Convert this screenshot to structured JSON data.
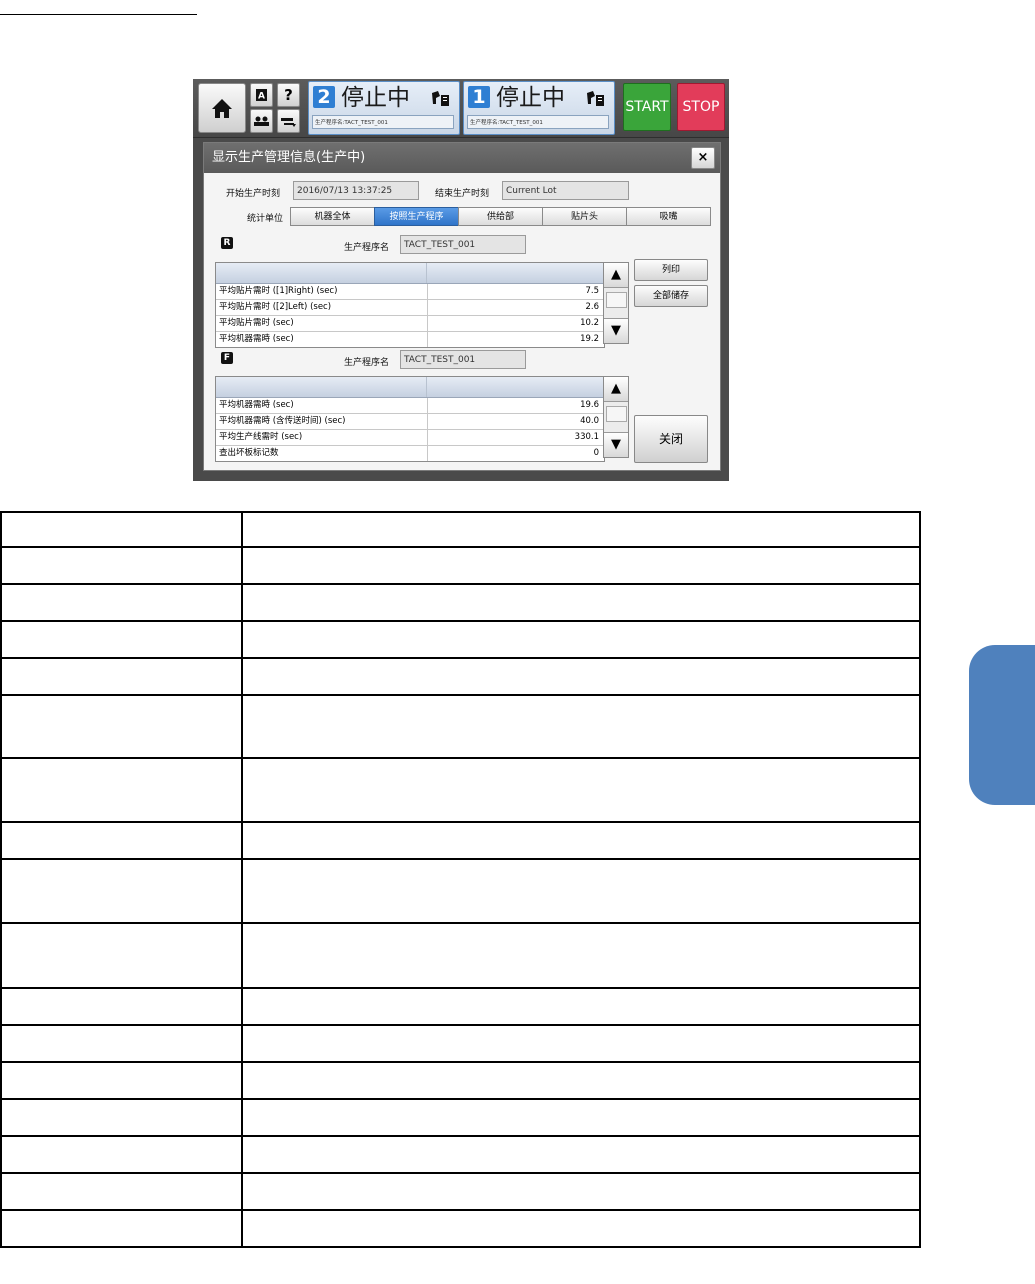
{
  "app": {
    "status_1": {
      "number": "2",
      "state": "停止中",
      "program": "生产程序名:TACT_TEST_001"
    },
    "status_2": {
      "number": "1",
      "state": "停止中",
      "program": "生产程序名:TACT_TEST_001"
    },
    "start_label": "START",
    "stop_label": "STOP",
    "help_label": "?",
    "a_label": "A"
  },
  "dialog": {
    "title": "显示生产管理信息(生产中)",
    "close_label": "×",
    "start_time_label": "开始生产时刻",
    "start_time_value": "2016/07/13 13:37:25",
    "end_time_label": "结束生产时刻",
    "end_time_value": "Current Lot",
    "unit_label": "统计单位",
    "tabs": [
      "机器全体",
      "按照生产程序",
      "供给部",
      "贴片头",
      "吸嘴"
    ],
    "active_tab": "按照生产程序",
    "rear": {
      "badge": "R",
      "program_label": "生产程序名",
      "program_value": "TACT_TEST_001",
      "rows": [
        {
          "k": "平均贴片需时 ([1]Right) (sec)",
          "v": "7.5"
        },
        {
          "k": "平均贴片需时 ([2]Left) (sec)",
          "v": "2.6"
        },
        {
          "k": "平均贴片需时 (sec)",
          "v": "10.2"
        },
        {
          "k": "平均机器需時 (sec)",
          "v": "19.2"
        }
      ]
    },
    "front": {
      "badge": "F",
      "program_label": "生产程序名",
      "program_value": "TACT_TEST_001",
      "rows": [
        {
          "k": "平均机器需時 (sec)",
          "v": "19.6"
        },
        {
          "k": "平均机器需時 (含传送时间) (sec)",
          "v": "40.0"
        },
        {
          "k": "平均生产线需时 (sec)",
          "v": "330.1"
        },
        {
          "k": "查出坏板标记数",
          "v": "0"
        }
      ]
    },
    "print_label": "列印",
    "save_all_label": "全部储存",
    "close_button_label": "关闭"
  },
  "colors": {
    "accent": "#2f74c9",
    "start": "#3aa53a",
    "stop": "#e23c5a",
    "side_tab": "#4f81bd"
  }
}
